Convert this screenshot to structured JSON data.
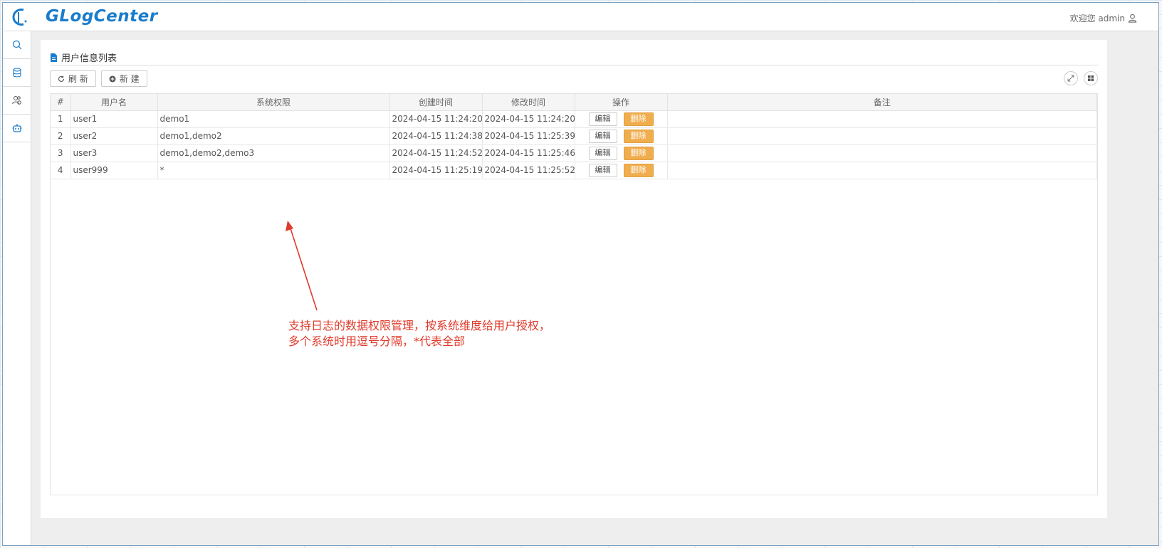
{
  "header": {
    "logo_text": "GLogCenter",
    "welcome": "欢迎您 admin"
  },
  "sidebar": {
    "items": [
      {
        "icon": "search-icon"
      },
      {
        "icon": "database-icon"
      },
      {
        "icon": "user-manage-icon"
      },
      {
        "icon": "robot-icon"
      }
    ]
  },
  "panel": {
    "title": "用户信息列表",
    "refresh_label": "刷 新",
    "new_label": "新 建"
  },
  "table": {
    "headers": [
      "#",
      "用户名",
      "系统权限",
      "创建时间",
      "修改时间",
      "操作",
      "备注"
    ],
    "edit_label": "编辑",
    "delete_label": "删除",
    "rows": [
      {
        "idx": "1",
        "username": "user1",
        "perm": "demo1",
        "created": "2024-04-15 11:24:20",
        "modified": "2024-04-15 11:24:20",
        "note": ""
      },
      {
        "idx": "2",
        "username": "user2",
        "perm": "demo1,demo2",
        "created": "2024-04-15 11:24:38",
        "modified": "2024-04-15 11:25:39",
        "note": ""
      },
      {
        "idx": "3",
        "username": "user3",
        "perm": "demo1,demo2,demo3",
        "created": "2024-04-15 11:24:52",
        "modified": "2024-04-15 11:25:46",
        "note": ""
      },
      {
        "idx": "4",
        "username": "user999",
        "perm": "*",
        "created": "2024-04-15 11:25:19",
        "modified": "2024-04-15 11:25:52",
        "note": ""
      }
    ]
  },
  "annotation": {
    "line1": "支持日志的数据权限管理，按系统维度给用户授权，",
    "line2": "多个系统时用逗号分隔，*代表全部"
  },
  "colors": {
    "accent": "#1a7ccc",
    "delete": "#f0ad4e",
    "annotation": "#e03a2a"
  }
}
